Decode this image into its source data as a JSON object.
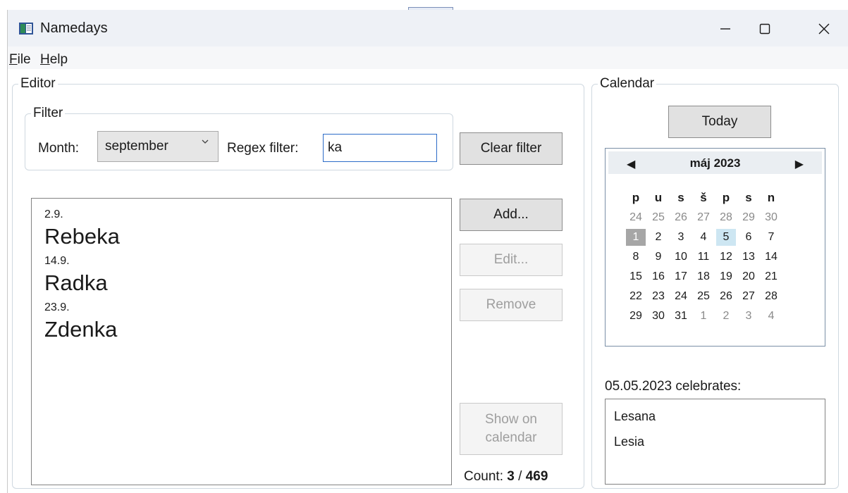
{
  "window": {
    "title": "Namedays",
    "minimize_glyph": "—",
    "maximize_glyph": "☐",
    "close_glyph": "✕"
  },
  "menu": [
    {
      "access_key": "F",
      "rest": "ile"
    },
    {
      "access_key": "H",
      "rest": "elp"
    }
  ],
  "editor": {
    "legend": "Editor",
    "filter": {
      "legend": "Filter",
      "month_label": "Month:",
      "month_value": "september",
      "regex_label": "Regex filter:",
      "regex_value": "ka"
    },
    "buttons": {
      "clear_filter": "Clear filter",
      "add": "Add...",
      "edit": "Edit...",
      "remove": "Remove",
      "show_line1": "Show on",
      "show_line2": "calendar"
    },
    "entries": [
      {
        "date": "2.9.",
        "name": "Rebeka"
      },
      {
        "date": "14.9.",
        "name": "Radka"
      },
      {
        "date": "23.9.",
        "name": "Zdenka"
      }
    ],
    "count": {
      "label": "Count:",
      "shown": "3",
      "separator": "/",
      "total": "469"
    }
  },
  "calendar": {
    "legend": "Calendar",
    "today_button": "Today",
    "month_title": "máj 2023",
    "prev_glyph": "◀",
    "next_glyph": "▶",
    "weekdays": [
      "p",
      "u",
      "s",
      "š",
      "p",
      "s",
      "n"
    ],
    "weeks": [
      [
        "24",
        "25",
        "26",
        "27",
        "28",
        "29",
        "30"
      ],
      [
        "1",
        "2",
        "3",
        "4",
        "5",
        "6",
        "7"
      ],
      [
        "8",
        "9",
        "10",
        "11",
        "12",
        "13",
        "14"
      ],
      [
        "15",
        "16",
        "17",
        "18",
        "19",
        "20",
        "21"
      ],
      [
        "22",
        "23",
        "24",
        "25",
        "26",
        "27",
        "28"
      ],
      [
        "29",
        "30",
        "31",
        "1",
        "2",
        "3",
        "4"
      ]
    ],
    "today_day": "1",
    "selected_day": "5",
    "celebrates_label": "05.05.2023 celebrates:",
    "celebrants": [
      "Lesana",
      "Lesia"
    ]
  }
}
